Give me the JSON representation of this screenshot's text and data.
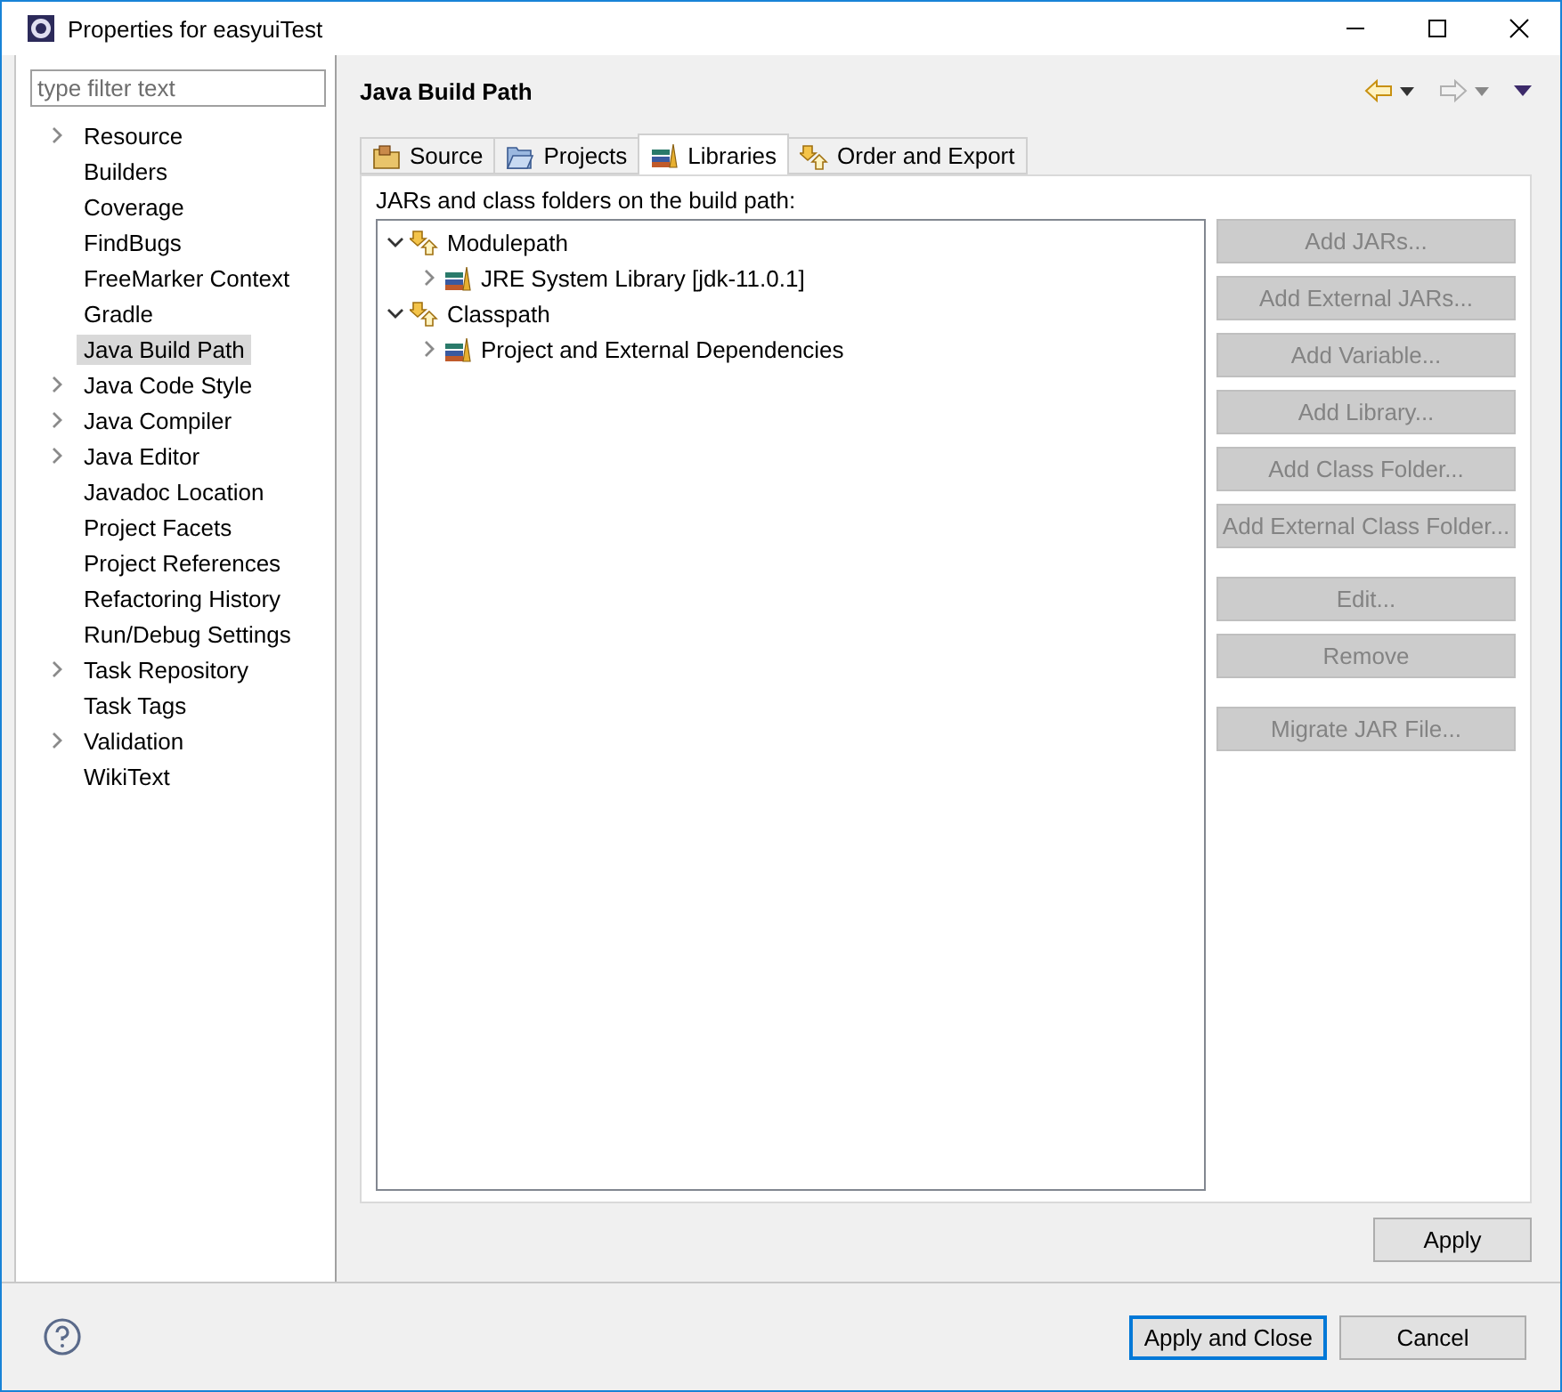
{
  "window": {
    "title": "Properties for easyuiTest"
  },
  "sidebar": {
    "filter": {
      "placeholder": "type filter text"
    },
    "items": [
      {
        "label": "Resource",
        "kind": "group",
        "expanded": false,
        "selected": false
      },
      {
        "label": "Builders",
        "kind": "leaf",
        "selected": false
      },
      {
        "label": "Coverage",
        "kind": "leaf",
        "selected": false
      },
      {
        "label": "FindBugs",
        "kind": "leaf",
        "selected": false
      },
      {
        "label": "FreeMarker Context",
        "kind": "leaf",
        "selected": false
      },
      {
        "label": "Gradle",
        "kind": "leaf",
        "selected": false
      },
      {
        "label": "Java Build Path",
        "kind": "leaf",
        "selected": true
      },
      {
        "label": "Java Code Style",
        "kind": "group",
        "expanded": false,
        "selected": false
      },
      {
        "label": "Java Compiler",
        "kind": "group",
        "expanded": false,
        "selected": false
      },
      {
        "label": "Java Editor",
        "kind": "group",
        "expanded": false,
        "selected": false
      },
      {
        "label": "Javadoc Location",
        "kind": "leaf",
        "selected": false
      },
      {
        "label": "Project Facets",
        "kind": "leaf",
        "selected": false
      },
      {
        "label": "Project References",
        "kind": "leaf",
        "selected": false
      },
      {
        "label": "Refactoring History",
        "kind": "leaf",
        "selected": false
      },
      {
        "label": "Run/Debug Settings",
        "kind": "leaf",
        "selected": false
      },
      {
        "label": "Task Repository",
        "kind": "group",
        "expanded": false,
        "selected": false
      },
      {
        "label": "Task Tags",
        "kind": "leaf",
        "selected": false
      },
      {
        "label": "Validation",
        "kind": "group",
        "expanded": false,
        "selected": false
      },
      {
        "label": "WikiText",
        "kind": "leaf",
        "selected": false
      }
    ]
  },
  "page": {
    "title": "Java Build Path",
    "back_disabled": false,
    "forward_disabled": true
  },
  "tabs": [
    {
      "label": "Source",
      "kind": "source",
      "selected": false
    },
    {
      "label": "Projects",
      "kind": "projects",
      "selected": false
    },
    {
      "label": "Libraries",
      "kind": "libraries",
      "selected": true
    },
    {
      "label": "Order and Export",
      "kind": "order",
      "selected": false
    }
  ],
  "libraries": {
    "caption": "JARs and class folders on the build path:",
    "tree": [
      {
        "label": "Modulepath",
        "kind": "container",
        "expanded": true,
        "children": [
          {
            "label": "JRE System Library [jdk-11.0.1]",
            "kind": "library",
            "expanded": false
          }
        ]
      },
      {
        "label": "Classpath",
        "kind": "container",
        "expanded": true,
        "children": [
          {
            "label": "Project and External Dependencies",
            "kind": "library",
            "expanded": false
          }
        ]
      }
    ],
    "button_groups": [
      [
        {
          "label": "Add JARs...",
          "disabled": true
        },
        {
          "label": "Add External JARs...",
          "disabled": true
        },
        {
          "label": "Add Variable...",
          "disabled": true
        },
        {
          "label": "Add Library...",
          "disabled": true
        },
        {
          "label": "Add Class Folder...",
          "disabled": true
        },
        {
          "label": "Add External Class Folder...",
          "disabled": true
        }
      ],
      [
        {
          "label": "Edit...",
          "disabled": true
        },
        {
          "label": "Remove",
          "disabled": true
        }
      ],
      [
        {
          "label": "Migrate JAR File...",
          "disabled": true
        }
      ]
    ]
  },
  "apply": "Apply",
  "footer": {
    "buttons": [
      {
        "label": "Apply and Close",
        "default": true
      },
      {
        "label": "Cancel",
        "default": false
      }
    ]
  }
}
